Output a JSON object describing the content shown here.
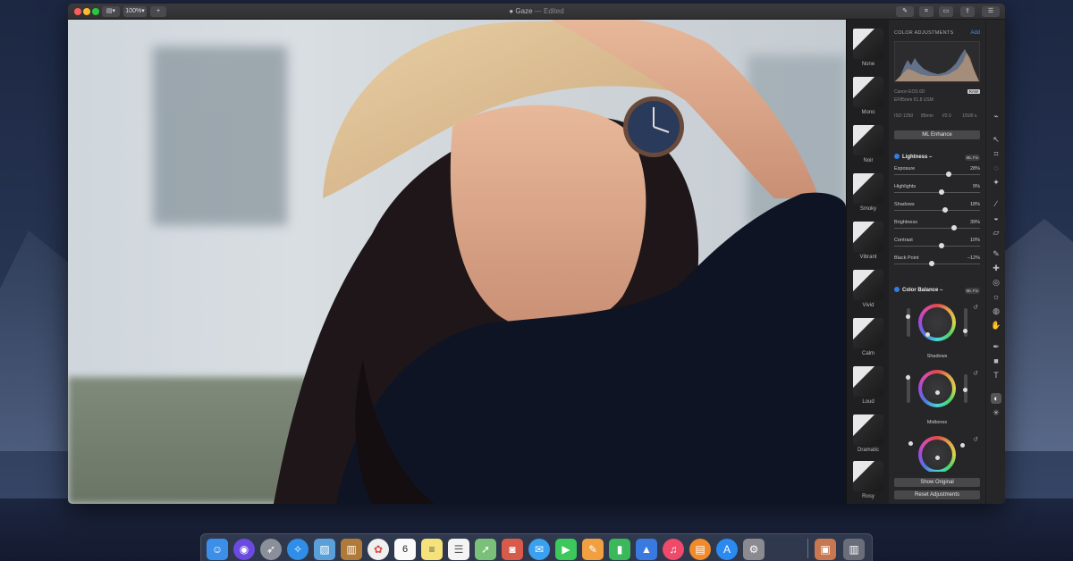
{
  "window": {
    "title": "Gaze",
    "title_suffix": "— Edited",
    "zoom": "100%"
  },
  "filters": [
    {
      "name": "None"
    },
    {
      "name": "Mono"
    },
    {
      "name": "Noir"
    },
    {
      "name": "Smoky"
    },
    {
      "name": "Vibrant"
    },
    {
      "name": "Vivid"
    },
    {
      "name": "Calm"
    },
    {
      "name": "Loud"
    },
    {
      "name": "Dramatic"
    },
    {
      "name": "Rosy"
    }
  ],
  "adjustments": {
    "header": "COLOR ADJUSTMENTS",
    "add_label": "Add",
    "camera": "Canon EOS 6D",
    "lens": "EF85mm f/1.8 USM",
    "raw_badge": "RAW",
    "iso": "ISO 1250",
    "focal": "85mm",
    "aperture": "f/2.0",
    "shutter": "1/500 s",
    "ml_enhance": "ML Enhance",
    "ml_badge": "ML Fix",
    "lightness": {
      "title": "Lightness –",
      "sliders": [
        {
          "label": "Exposure",
          "value": "28%",
          "fraction": 0.64
        },
        {
          "label": "Highlights",
          "value": "9%",
          "fraction": 0.55
        },
        {
          "label": "Shadows",
          "value": "18%",
          "fraction": 0.59
        },
        {
          "label": "Brightness",
          "value": "39%",
          "fraction": 0.7
        },
        {
          "label": "Contrast",
          "value": "10%",
          "fraction": 0.55
        },
        {
          "label": "Black Point",
          "value": "–12%",
          "fraction": 0.44
        }
      ]
    },
    "color_balance": {
      "title": "Color Balance –",
      "wheels": [
        {
          "label": "Shadows"
        },
        {
          "label": "Midtones"
        }
      ]
    },
    "show_original": "Show Original",
    "reset": "Reset Adjustments"
  },
  "tool_icons": [
    "paint-icon",
    "arrow-icon",
    "crop-icon",
    "lasso-icon",
    "magic-wand-icon",
    "brush-icon",
    "bucket-icon",
    "eraser-icon",
    "pencil-icon",
    "repair-icon",
    "clone-icon",
    "sun-icon",
    "blur-icon",
    "hand-icon",
    "pen-icon",
    "shape-icon",
    "text-icon",
    "color-icon",
    "light-icon"
  ],
  "dock": {
    "calendar_day": "6",
    "apps": [
      "finder-icon",
      "siri-icon",
      "launchpad-icon",
      "safari-icon",
      "preview-icon",
      "notefile-icon",
      "photos-icon",
      "calendar-icon",
      "notes-icon",
      "reminders-icon",
      "maps-icon",
      "photo-booth-icon",
      "messages-icon",
      "facetime-icon",
      "pages-icon",
      "numbers-icon",
      "keynote-icon",
      "music-icon",
      "books-icon",
      "app-store-icon",
      "settings-icon",
      "pixelmator-icon",
      "trash-icon"
    ]
  }
}
